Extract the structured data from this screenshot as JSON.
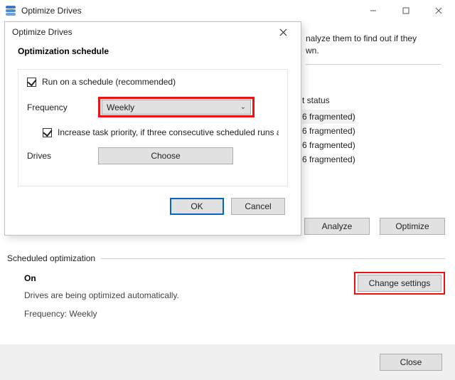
{
  "parent": {
    "title": "Optimize Drives",
    "description_fragment_right": "nalyze them to find out if they",
    "description_fragment_right2": "wn.",
    "status_header": "t status",
    "status_rows": [
      "6 fragmented)",
      "6 fragmented)",
      "6 fragmented)",
      "6 fragmented)"
    ],
    "analyze_label": "Analyze",
    "optimize_label": "Optimize",
    "scheduled_section_title": "Scheduled optimization",
    "scheduled_state": "On",
    "scheduled_desc": "Drives are being optimized automatically.",
    "scheduled_freq": "Frequency: Weekly",
    "change_settings_label": "Change settings",
    "close_label": "Close"
  },
  "dialog": {
    "title": "Optimize Drives",
    "heading": "Optimization schedule",
    "run_schedule_label": "Run on a schedule (recommended)",
    "frequency_label": "Frequency",
    "frequency_value": "Weekly",
    "increase_priority_label": "Increase task priority, if three consecutive scheduled runs are m",
    "drives_label": "Drives",
    "choose_label": "Choose",
    "ok_label": "OK",
    "cancel_label": "Cancel"
  }
}
